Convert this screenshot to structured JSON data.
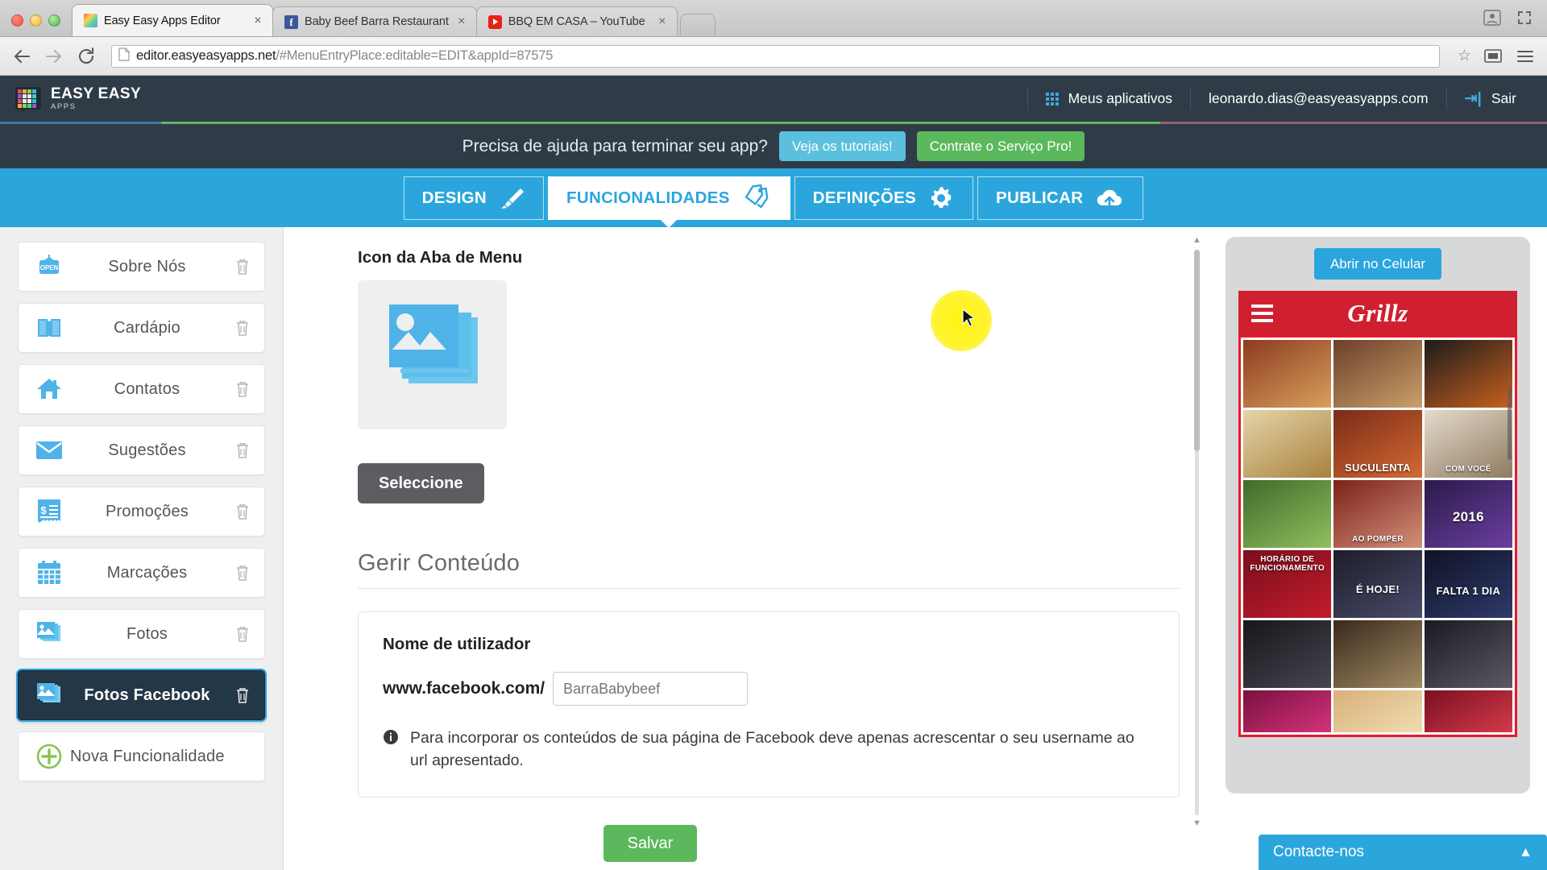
{
  "browser": {
    "tabs": [
      {
        "title": "Easy Easy Apps Editor",
        "favicon": "easyeasy-icon",
        "active": true,
        "close": "×"
      },
      {
        "title": "Baby Beef Barra Restaurant",
        "favicon": "facebook-icon",
        "active": false,
        "close": "×"
      },
      {
        "title": "BBQ EM CASA – YouTube",
        "favicon": "youtube-icon",
        "active": false,
        "close": "×"
      }
    ],
    "url_prefix": "editor.easyeasyapps.net",
    "url_suffix": "/#MenuEntryPlace:editable=EDIT&appId=87575",
    "url_full": "editor.easyeasyapps.net/#MenuEntryPlace:editable=EDIT&appId=87575",
    "back_icon": "back-arrow-icon",
    "forward_icon": "forward-arrow-icon",
    "reload_icon": "reload-icon",
    "page_icon": "page-icon",
    "star_icon": "bookmark-star-icon",
    "cast_icon": "cast-icon",
    "menu_icon": "hamburger-menu-icon",
    "profile_icon": "profile-icon",
    "expand_icon": "fullscreen-icon",
    "newtab_label": ""
  },
  "header": {
    "brand_line1": "EASY EASY",
    "brand_line2": "APPS",
    "apps_label": "Meus aplicativos",
    "user_email": "leonardo.dias@easyeasyapps.com",
    "logout_label": "Sair",
    "grid_icon": "apps-grid-icon",
    "logout_icon": "logout-icon",
    "bg": "#2f3c48"
  },
  "help_bar": {
    "text": "Precisa de ajuda para terminar seu app?",
    "tutorials_button": "Veja os tutoriais!",
    "pro_button": "Contrate o Serviço Pro!",
    "tutorials_color": "#5bc0de",
    "pro_color": "#5cb85c"
  },
  "nav_tabs": {
    "accent": "#2ba6dd",
    "items": [
      {
        "label": "DESIGN",
        "icon": "paintbrush-icon",
        "active": false
      },
      {
        "label": "FUNCIONALIDADES",
        "icon": "tags-icon",
        "active": true
      },
      {
        "label": "DEFINIÇÕES",
        "icon": "gear-icon",
        "active": false
      },
      {
        "label": "PUBLICAR",
        "icon": "upload-cloud-icon",
        "active": false
      }
    ]
  },
  "sidebar": {
    "items": [
      {
        "label": "Sobre Nós",
        "icon": "open-sign-icon",
        "selected": false,
        "trash": "trash-icon"
      },
      {
        "label": "Cardápio",
        "icon": "book-icon",
        "selected": false,
        "trash": "trash-icon"
      },
      {
        "label": "Contatos",
        "icon": "home-icon",
        "selected": false,
        "trash": "trash-icon"
      },
      {
        "label": "Sugestões",
        "icon": "envelope-icon",
        "selected": false,
        "trash": "trash-icon"
      },
      {
        "label": "Promoções",
        "icon": "receipt-icon",
        "selected": false,
        "trash": "trash-icon"
      },
      {
        "label": "Marcações",
        "icon": "calendar-icon",
        "selected": false,
        "trash": "trash-icon"
      },
      {
        "label": "Fotos",
        "icon": "photos-icon",
        "selected": false,
        "trash": "trash-icon"
      },
      {
        "label": "Fotos Facebook",
        "icon": "photos-icon",
        "selected": true,
        "trash": "trash-icon"
      }
    ],
    "new_feature": {
      "label": "Nova Funcionalidade",
      "icon": "plus-circle-icon"
    }
  },
  "main": {
    "icon_section_title": "Icon da Aba de Menu",
    "icon_preview": "photos-placeholder-icon",
    "select_button": "Seleccione",
    "manage_title": "Gerir Conteúdo",
    "card": {
      "field_label": "Nome de utilizador",
      "url_prefix": "www.facebook.com/",
      "input_value": "",
      "input_placeholder": "BarraBabybeef",
      "note_icon": "info-icon",
      "note": "Para incorporar os conteúdos de sua página de Facebook deve apenas acrescentar o seu username ao url apresentado."
    },
    "save_button": "Salvar",
    "scroll_up_icon": "scroll-up-arrow",
    "scroll_down_icon": "scroll-down-arrow"
  },
  "preview": {
    "open_mobile_button": "Abrir no Celular",
    "app_title": "Grillz",
    "menu_icon": "hamburger-icon",
    "topbar_color": "#d02030",
    "highlight_color": "#e8192c",
    "photos": [
      {
        "caption": "",
        "c1": "#8c3b21",
        "c2": "#d9a05b"
      },
      {
        "caption": "",
        "c1": "#6b3f2a",
        "c2": "#caa06a"
      },
      {
        "caption": "",
        "c1": "#1b1b1b",
        "c2": "#c9601f"
      },
      {
        "caption": "",
        "c1": "#d8c08a",
        "c2": "#a8823f"
      },
      {
        "caption": "SUCULENTA",
        "c1": "#7a2b17",
        "c2": "#d46a33"
      },
      {
        "caption": "COM VOCÊ",
        "c1": "#d8cfc0",
        "c2": "#8f7a60"
      },
      {
        "caption": "",
        "c1": "#3f6b2a",
        "c2": "#8fbf5e"
      },
      {
        "caption": "AO POMPER",
        "c1": "#7b2218",
        "c2": "#d3907a"
      },
      {
        "caption": "2016",
        "c1": "#2a1a4a",
        "c2": "#6b3fa0",
        "big": true
      },
      {
        "caption": "HORÁRIO DE FUNCIONAMENTO",
        "c1": "#7a0e1c",
        "c2": "#c21c2c"
      },
      {
        "caption": "É HOJE!",
        "c1": "#1d1d2a",
        "c2": "#4a4a6a",
        "mid": true
      },
      {
        "caption": "FALTA 1 DIA",
        "c1": "#101225",
        "c2": "#2e3a6b",
        "mid": true
      },
      {
        "caption": "",
        "c1": "#16161c",
        "c2": "#46464f"
      },
      {
        "caption": "",
        "c1": "#3a2a1c",
        "c2": "#a08a63"
      },
      {
        "caption": "",
        "c1": "#1a1a22",
        "c2": "#5a5a66"
      },
      {
        "caption": "",
        "c1": "#7a1040",
        "c2": "#d4337a"
      },
      {
        "caption": "",
        "c1": "#d9b07a",
        "c2": "#f0dcb0"
      },
      {
        "caption": "",
        "c1": "#7a1020",
        "c2": "#d43a4a"
      }
    ],
    "contact_widget": {
      "label": "Contacte-nos",
      "chevron": "chevron-up-icon",
      "color": "#2ba6dd"
    }
  }
}
